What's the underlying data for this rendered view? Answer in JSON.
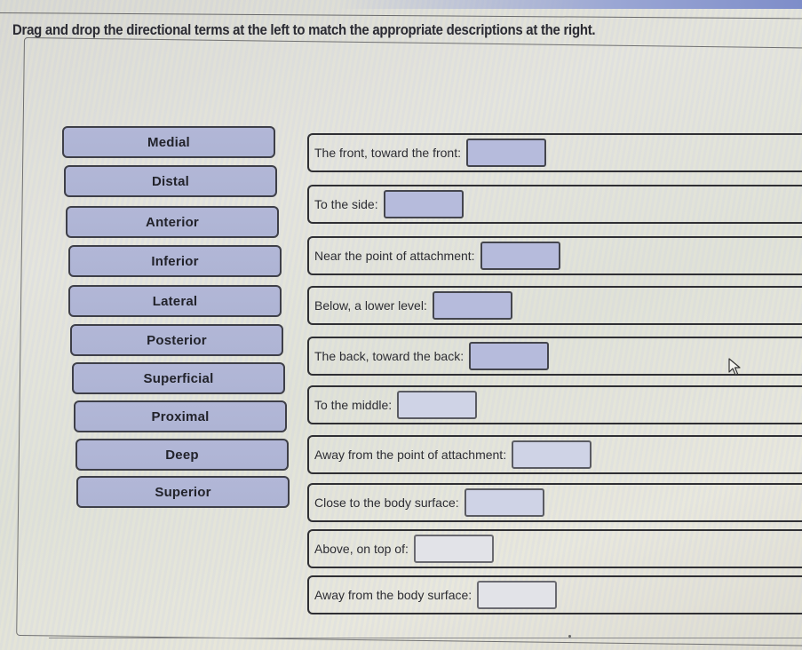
{
  "instructions": "Drag and drop the directional terms at the left to match the appropriate descriptions at the right.",
  "terms": [
    {
      "label": "Medial"
    },
    {
      "label": "Distal"
    },
    {
      "label": "Anterior"
    },
    {
      "label": "Inferior"
    },
    {
      "label": "Lateral"
    },
    {
      "label": "Posterior"
    },
    {
      "label": "Superficial"
    },
    {
      "label": "Proximal"
    },
    {
      "label": "Deep"
    },
    {
      "label": "Superior"
    }
  ],
  "descriptions": [
    {
      "label": "The front, toward the front:",
      "answer": ""
    },
    {
      "label": "To the side:",
      "answer": ""
    },
    {
      "label": "Near the point of attachment:",
      "answer": ""
    },
    {
      "label": "Below, a lower level:",
      "answer": ""
    },
    {
      "label": "The back, toward the back:",
      "answer": ""
    },
    {
      "label": "To the middle:",
      "answer": ""
    },
    {
      "label": "Away from the point of attachment:",
      "answer": ""
    },
    {
      "label": "Close to the body surface:",
      "answer": ""
    },
    {
      "label": "Above, on top of:",
      "answer": ""
    },
    {
      "label": "Away from the body surface:",
      "answer": ""
    }
  ],
  "colors": {
    "term_fill": "#b2b7d7",
    "slot_fill": "#b6bbdc",
    "border": "#2f2f33",
    "text": "#22232b"
  }
}
